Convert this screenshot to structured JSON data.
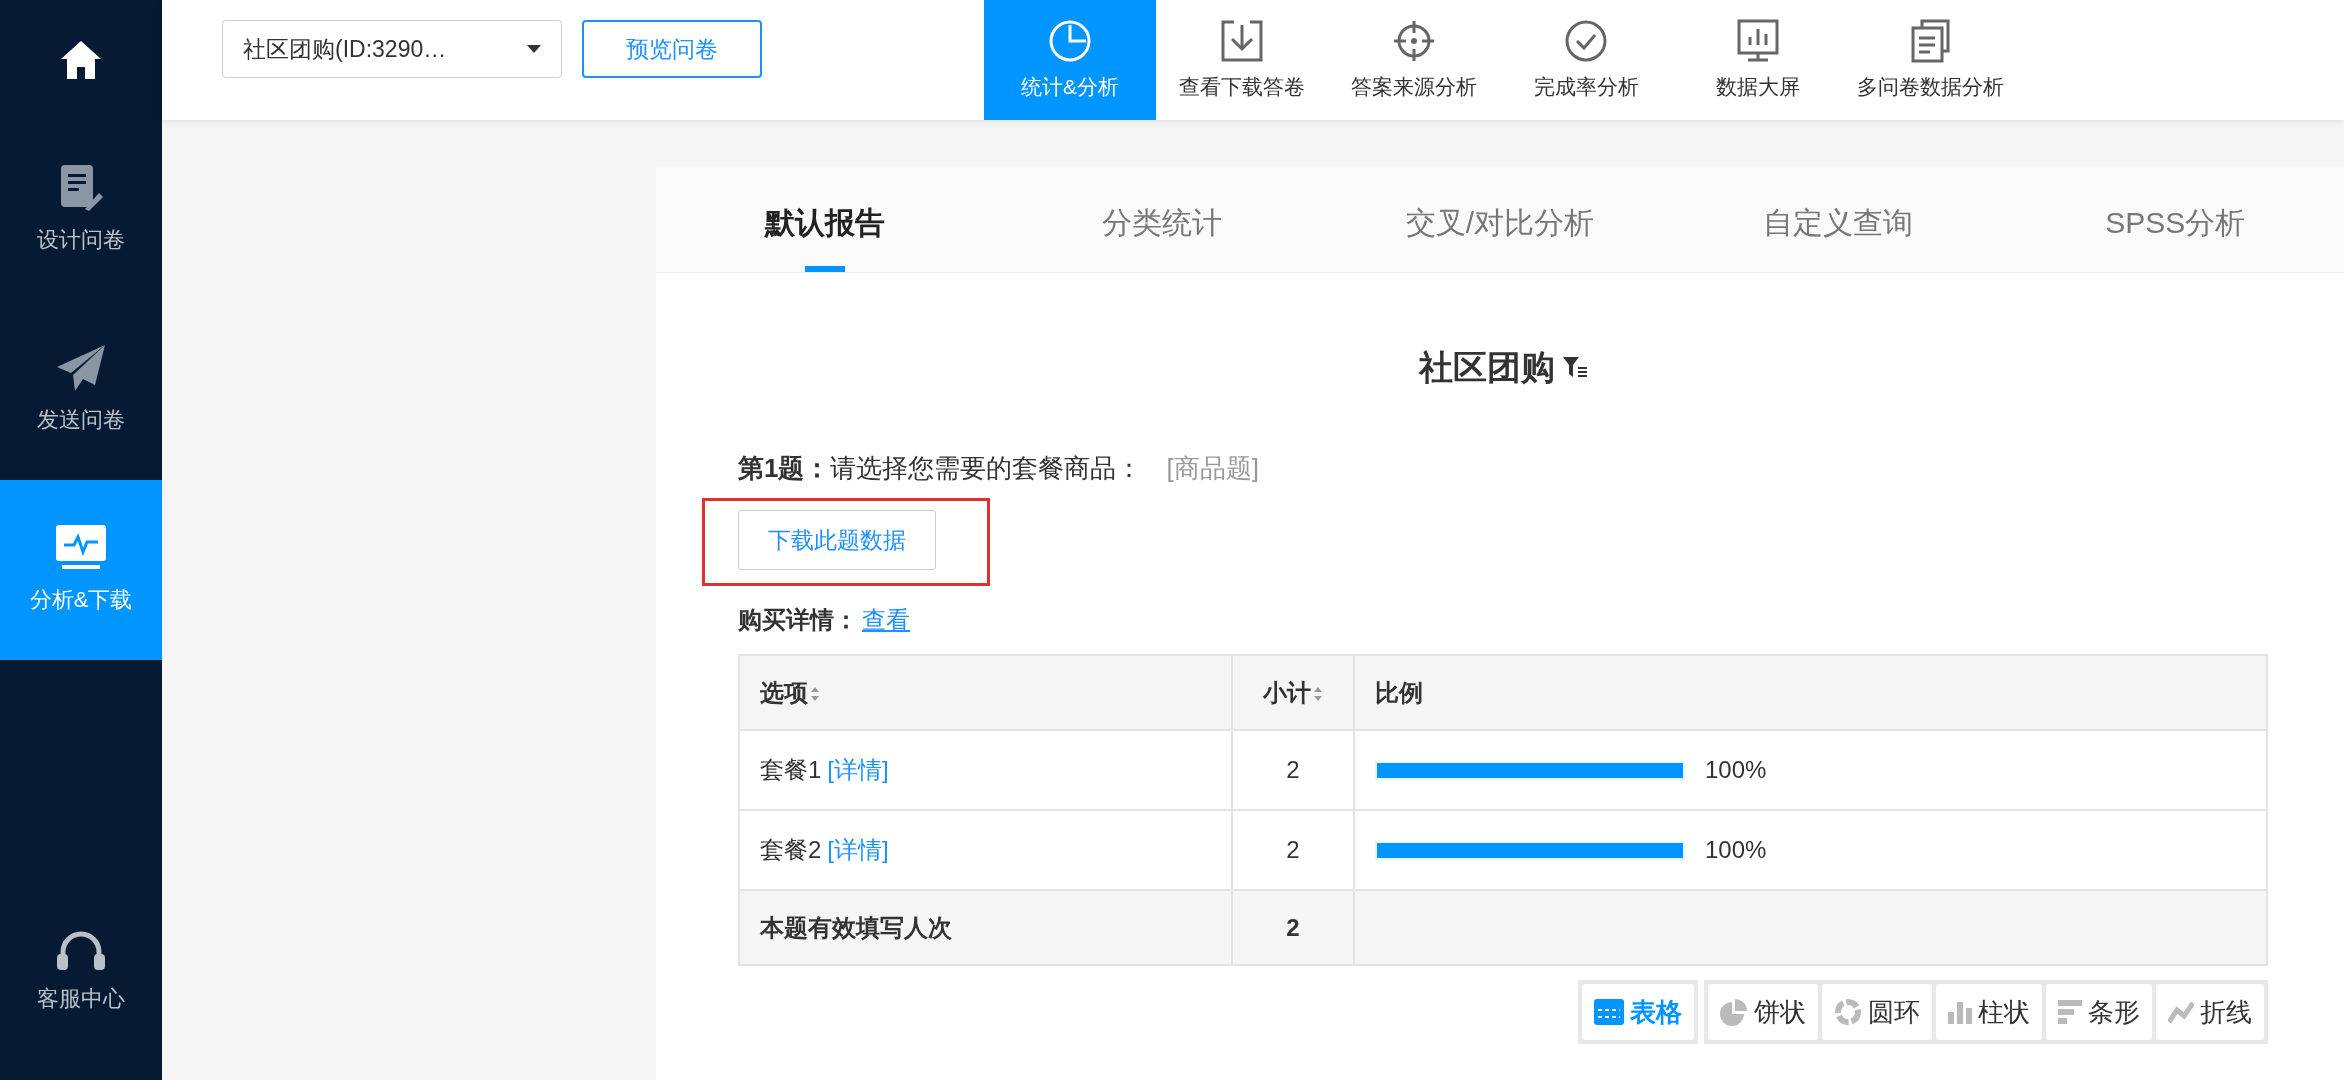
{
  "sidebar": {
    "items": [
      {
        "kind": "design",
        "label": "设计问卷",
        "selected": false
      },
      {
        "kind": "send",
        "label": "发送问卷",
        "selected": false
      },
      {
        "kind": "analyze",
        "label": "分析&下载",
        "selected": true
      }
    ],
    "footer_item": {
      "kind": "support",
      "label": "客服中心"
    }
  },
  "topbar": {
    "survey_select": {
      "value": "社区团购(ID:3290…"
    },
    "preview_button": "预览问卷",
    "nav": [
      {
        "kind": "stats",
        "label": "统计&分析",
        "selected": true
      },
      {
        "kind": "download",
        "label": "查看下载答卷",
        "selected": false
      },
      {
        "kind": "source",
        "label": "答案来源分析",
        "selected": false
      },
      {
        "kind": "completion",
        "label": "完成率分析",
        "selected": false
      },
      {
        "kind": "screen",
        "label": "数据大屏",
        "selected": false
      },
      {
        "kind": "multi",
        "label": "多问卷数据分析",
        "selected": false
      }
    ]
  },
  "report_tabs": [
    {
      "label": "默认报告",
      "selected": true
    },
    {
      "label": "分类统计",
      "selected": false
    },
    {
      "label": "交叉/对比分析",
      "selected": false
    },
    {
      "label": "自定义查询",
      "selected": false
    },
    {
      "label": "SPSS分析",
      "selected": false
    }
  ],
  "report": {
    "title": "社区团购",
    "question": {
      "number": "第1题：",
      "text": "请选择您需要的套餐商品：",
      "type": "[商品题]"
    },
    "download_button": {
      "label": "下载此题数据",
      "highlighted": true
    },
    "purchase_details": {
      "label": "购买详情：",
      "link": "查看"
    },
    "table": {
      "columns": [
        {
          "label": "选项",
          "sortable": true
        },
        {
          "label": "小计",
          "sortable": true
        },
        {
          "label": "比例",
          "sortable": false
        }
      ],
      "rows": [
        {
          "option": "套餐1",
          "detail_link": "[详情]",
          "count": "2",
          "level": 1,
          "percent": "100%"
        },
        {
          "option": "套餐2",
          "detail_link": "[详情]",
          "count": "2",
          "level": 1,
          "percent": "100%"
        }
      ],
      "total": {
        "label": "本题有效填写人次",
        "count": "2"
      }
    },
    "view_buttons": [
      {
        "kind": "table",
        "label": "表格",
        "selected": true
      },
      {
        "kind": "pie",
        "label": "饼状",
        "selected": false
      },
      {
        "kind": "ring",
        "label": "圆环",
        "selected": false
      },
      {
        "kind": "column",
        "label": "柱状",
        "selected": false
      },
      {
        "kind": "bar",
        "label": "条形",
        "selected": false
      },
      {
        "kind": "line",
        "label": "折线",
        "selected": false
      }
    ]
  }
}
